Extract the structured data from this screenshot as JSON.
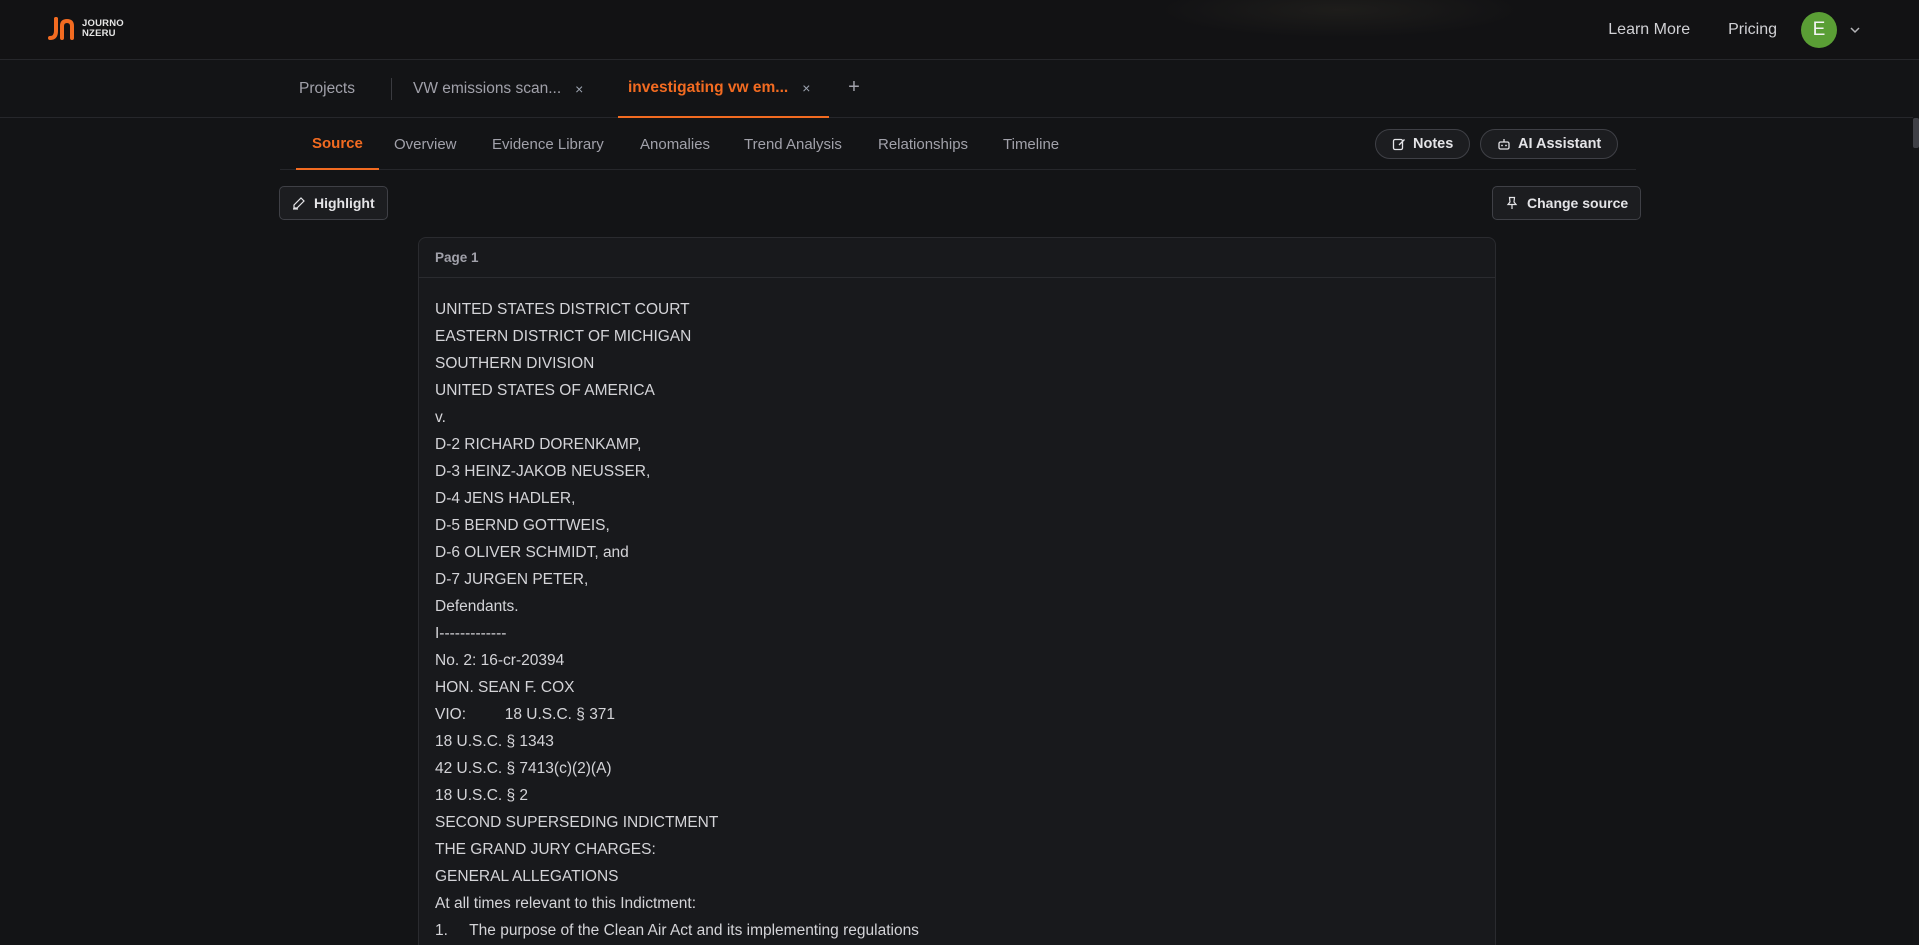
{
  "header": {
    "logo_line1": "JOURNO",
    "logo_line2": "NZERU",
    "learn_more": "Learn More",
    "pricing": "Pricing",
    "avatar_initial": "E",
    "brand_color": "#f26b21",
    "avatar_color": "#5a9e35"
  },
  "tabs": {
    "projects": "Projects",
    "tab1_label": "VW emissions scan...",
    "tab2_label": "investigating vw em...",
    "close_glyph": "×",
    "add_glyph": "+"
  },
  "subnav": {
    "items": [
      "Source",
      "Overview",
      "Evidence Library",
      "Anomalies",
      "Trend Analysis",
      "Relationships",
      "Timeline"
    ],
    "active": "Source",
    "notes": "Notes",
    "ai_assistant": "AI Assistant"
  },
  "toolbar": {
    "highlight": "Highlight",
    "change_source": "Change source"
  },
  "document": {
    "page_label": "Page 1",
    "lines": [
      "UNITED STATES DISTRICT COURT",
      "EASTERN DISTRICT OF MICHIGAN",
      "SOUTHERN DIVISION",
      "UNITED STATES OF AMERICA",
      "v.",
      "D-2 RICHARD DORENKAMP,",
      "D-3 HEINZ-JAKOB NEUSSER,",
      "D-4 JENS HADLER,",
      "D-5 BERND GOTTWEIS,",
      "D-6 OLIVER SCHMIDT, and",
      "D-7 JURGEN PETER,",
      "Defendants.",
      "I-------------",
      "No. 2: 16-cr-20394",
      "HON. SEAN F. COX",
      "VIO:         18 U.S.C. § 371",
      "18 U.S.C. § 1343",
      "42 U.S.C. § 7413(c)(2)(A)",
      "18 U.S.C. § 2",
      "SECOND SUPERSEDING INDICTMENT",
      "THE GRAND JURY CHARGES:",
      "GENERAL ALLEGATIONS",
      "At all times relevant to this Indictment:",
      "1.     The purpose of the Clean Air Act and its implementing regulations"
    ]
  }
}
